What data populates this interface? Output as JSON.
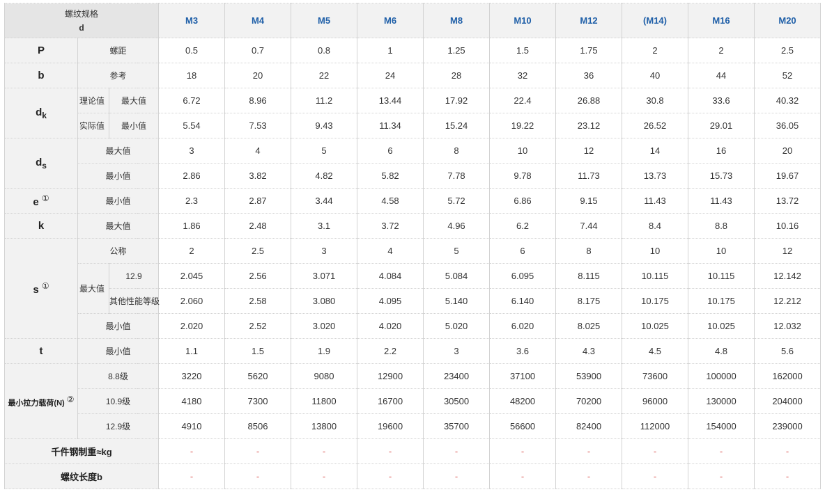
{
  "header": {
    "spec_label": "螺纹规格",
    "d_label": "d",
    "sizes": [
      "M3",
      "M4",
      "M5",
      "M6",
      "M8",
      "M10",
      "M12",
      "(M14)",
      "M16",
      "M20"
    ]
  },
  "rows": {
    "P": {
      "sym": "P",
      "label": "螺距",
      "values": [
        "0.5",
        "0.7",
        "0.8",
        "1",
        "1.25",
        "1.5",
        "1.75",
        "2",
        "2",
        "2.5"
      ]
    },
    "b": {
      "sym": "b",
      "label": "参考",
      "values": [
        "18",
        "20",
        "22",
        "24",
        "28",
        "32",
        "36",
        "40",
        "44",
        "52"
      ]
    },
    "dk": {
      "sym": "d",
      "sub": "k",
      "max": {
        "group": "理论值",
        "label": "最大值",
        "values": [
          "6.72",
          "8.96",
          "11.2",
          "13.44",
          "17.92",
          "22.4",
          "26.88",
          "30.8",
          "33.6",
          "40.32"
        ]
      },
      "min": {
        "group": "实际值",
        "label": "最小值",
        "values": [
          "5.54",
          "7.53",
          "9.43",
          "11.34",
          "15.24",
          "19.22",
          "23.12",
          "26.52",
          "29.01",
          "36.05"
        ]
      }
    },
    "ds": {
      "sym": "d",
      "sub": "s",
      "max": {
        "label": "最大值",
        "values": [
          "3",
          "4",
          "5",
          "6",
          "8",
          "10",
          "12",
          "14",
          "16",
          "20"
        ]
      },
      "min": {
        "label": "最小值",
        "values": [
          "2.86",
          "3.82",
          "4.82",
          "5.82",
          "7.78",
          "9.78",
          "11.73",
          "13.73",
          "15.73",
          "19.67"
        ]
      }
    },
    "e": {
      "sym": "e",
      "mark": "①",
      "label": "最小值",
      "values": [
        "2.3",
        "2.87",
        "3.44",
        "4.58",
        "5.72",
        "6.86",
        "9.15",
        "11.43",
        "11.43",
        "13.72"
      ]
    },
    "k": {
      "sym": "k",
      "label": "最大值",
      "values": [
        "1.86",
        "2.48",
        "3.1",
        "3.72",
        "4.96",
        "6.2",
        "7.44",
        "8.4",
        "8.8",
        "10.16"
      ]
    },
    "s": {
      "sym": "s",
      "mark": "①",
      "nominal": {
        "label": "公称",
        "values": [
          "2",
          "2.5",
          "3",
          "4",
          "5",
          "6",
          "8",
          "10",
          "10",
          "12"
        ]
      },
      "max_group": "最大值",
      "max129": {
        "label": "12.9",
        "values": [
          "2.045",
          "2.56",
          "3.071",
          "4.084",
          "5.084",
          "6.095",
          "8.115",
          "10.115",
          "10.115",
          "12.142"
        ]
      },
      "maxother": {
        "label": "其他性能等级",
        "values": [
          "2.060",
          "2.58",
          "3.080",
          "4.095",
          "5.140",
          "6.140",
          "8.175",
          "10.175",
          "10.175",
          "12.212"
        ]
      },
      "min": {
        "label": "最小值",
        "values": [
          "2.020",
          "2.52",
          "3.020",
          "4.020",
          "5.020",
          "6.020",
          "8.025",
          "10.025",
          "10.025",
          "12.032"
        ]
      }
    },
    "t": {
      "sym": "t",
      "label": "最小值",
      "values": [
        "1.1",
        "1.5",
        "1.9",
        "2.2",
        "3",
        "3.6",
        "4.3",
        "4.5",
        "4.8",
        "5.6"
      ]
    },
    "load": {
      "sym": "最小拉力载荷(N)",
      "mark": "②",
      "g88": {
        "label": "8.8级",
        "values": [
          "3220",
          "5620",
          "9080",
          "12900",
          "23400",
          "37100",
          "53900",
          "73600",
          "100000",
          "162000"
        ]
      },
      "g109": {
        "label": "10.9级",
        "values": [
          "4180",
          "7300",
          "11800",
          "16700",
          "30500",
          "48200",
          "70200",
          "96000",
          "130000",
          "204000"
        ]
      },
      "g129": {
        "label": "12.9级",
        "values": [
          "4910",
          "8506",
          "13800",
          "19600",
          "35700",
          "56600",
          "82400",
          "112000",
          "154000",
          "239000"
        ]
      }
    },
    "weight": {
      "label": "千件钢制重≈kg",
      "values": [
        "-",
        "-",
        "-",
        "-",
        "-",
        "-",
        "-",
        "-",
        "-",
        "-"
      ]
    },
    "thread_len": {
      "label": "螺纹长度b",
      "values": [
        "-",
        "-",
        "-",
        "-",
        "-",
        "-",
        "-",
        "-",
        "-",
        "-"
      ]
    }
  }
}
